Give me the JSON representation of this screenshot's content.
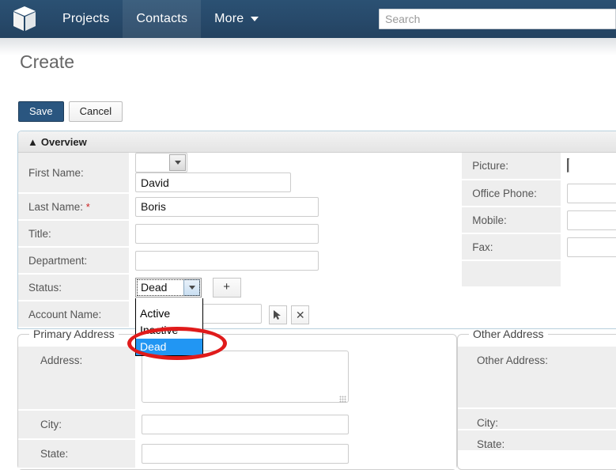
{
  "navbar": {
    "logo_icon": "cube-logo-icon",
    "items": [
      {
        "label": "Projects",
        "active": false
      },
      {
        "label": "Contacts",
        "active": true
      },
      {
        "label": "More",
        "active": false,
        "has_caret": true
      }
    ],
    "search": {
      "placeholder": "Search",
      "value": ""
    },
    "bg_color": "#27496a"
  },
  "page": {
    "title": "Create"
  },
  "toolbar": {
    "save_label": "Save",
    "cancel_label": "Cancel",
    "primary_color": "#2a5680"
  },
  "overview": {
    "header_label": "Overview",
    "collapse_icon": "chevron-up-icon",
    "left_fields": {
      "first_name_label": "First Name:",
      "salutation_value": "",
      "first_name_value": "David",
      "last_name_label": "Last Name:",
      "last_name_required": "*",
      "last_name_value": "Boris",
      "title_label": "Title:",
      "title_value": "",
      "department_label": "Department:",
      "department_value": "",
      "status_label": "Status:",
      "status_value": "Dead",
      "status_add_label": "+",
      "account_name_label": "Account Name:",
      "account_name_value": ""
    },
    "status_dropdown": {
      "open": true,
      "options": [
        "Active",
        "Inactive",
        "Dead"
      ],
      "selected": "Dead",
      "highlight_color": "#2196f3"
    },
    "right_fields": {
      "picture_label": "Picture:",
      "picture_value": "",
      "office_phone_label": "Office Phone:",
      "office_phone_value": "",
      "mobile_label": "Mobile:",
      "mobile_value": "",
      "fax_label": "Fax:",
      "fax_value": ""
    },
    "account_picker_icon": "cursor-arrow-icon",
    "account_clear_icon": "close-x-icon"
  },
  "primary_address": {
    "legend": "Primary Address",
    "address_label": "Address:",
    "address_value": "",
    "city_label": "City:",
    "city_value": "",
    "state_label": "State:",
    "state_value": ""
  },
  "other_address": {
    "legend": "Other Address",
    "address_label": "Other Address:",
    "city_label": "City:",
    "state_label": "State:"
  },
  "annotation": {
    "shape": "ellipse",
    "color": "#e01b1b",
    "targets": "Dead option in status dropdown"
  }
}
